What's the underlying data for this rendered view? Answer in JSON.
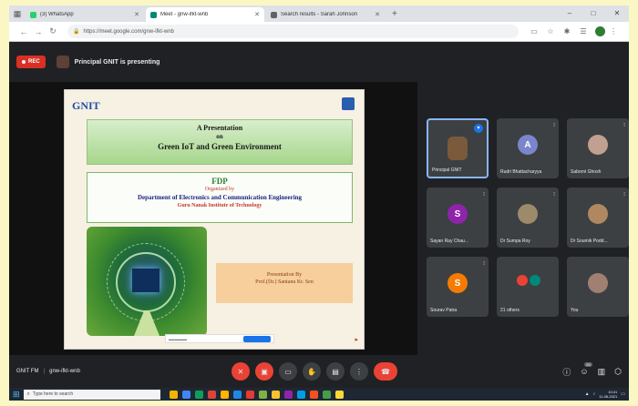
{
  "browser": {
    "tabs": [
      {
        "label": "(3) WhatsApp",
        "favicon_color": "#25d366",
        "active": false
      },
      {
        "label": "Meet - gnw-ifkt-wnb",
        "favicon_color": "#00897b",
        "active": true
      },
      {
        "label": "Search results - Sarah Johnson",
        "favicon_color": "#5f6368",
        "active": false
      }
    ],
    "new_tab": "+",
    "window_controls": [
      "–",
      "□",
      "✕"
    ],
    "url": "https://meet.google.com/gnw-ifkt-wnb"
  },
  "meet": {
    "recording_label": "REC",
    "presenter_text": "Principal GNIT is presenting",
    "slide": {
      "logo": "GNIT",
      "title_line1": "A Presentation",
      "title_line2": "on",
      "title_line3": "Green IoT and Green Environment",
      "fdp_title": "FDP",
      "organized_by": "Organized by",
      "department": "Department of Electronics and Communication Engineering",
      "institute": "Guru Nanak Institute of Technology",
      "presentation_by": "Presentation By",
      "presenter_name": "Prof.(Dr.) Santanu Kr. Sen"
    },
    "participants": [
      {
        "name": "Principal GNIT",
        "initial": "",
        "avatar_color": "#7a5a3a",
        "active": true
      },
      {
        "name": "Rudri Bhattacharyya",
        "initial": "A",
        "avatar_color": "#7986cb",
        "active": false
      },
      {
        "name": "Saborni Ghosh",
        "initial": "",
        "avatar_color": "#c0a090",
        "active": false
      },
      {
        "name": "Sayan Ray Chau...",
        "initial": "S",
        "avatar_color": "#8e24aa",
        "active": false
      },
      {
        "name": "Dr Sumpa Roy",
        "initial": "",
        "avatar_color": "#9c8a6a",
        "active": false
      },
      {
        "name": "Dr Soumik Podd...",
        "initial": "",
        "avatar_color": "#b08860",
        "active": false
      },
      {
        "name": "Sourav Patra",
        "initial": "S",
        "avatar_color": "#f57c00",
        "active": false
      },
      {
        "name": "21 others",
        "initial": "",
        "avatar_color": "#ea4335",
        "active": false
      },
      {
        "name": "You",
        "initial": "",
        "avatar_color": "#a08070",
        "active": false
      }
    ],
    "meeting_name": "GNIT FM",
    "meeting_code": "gnw-ifkt-wnb",
    "participant_count": "29"
  },
  "taskbar": {
    "search_placeholder": "Type here to search",
    "app_colors": [
      "#f4b400",
      "#4285f4",
      "#0f9d58",
      "#db4437",
      "#ffb300",
      "#1e88e5",
      "#e53935",
      "#7cb342",
      "#fbc02d",
      "#8e24aa",
      "#039be5",
      "#f4511e",
      "#43a047",
      "#fdd835"
    ],
    "time": "10:41",
    "date": "11-08-2021"
  }
}
